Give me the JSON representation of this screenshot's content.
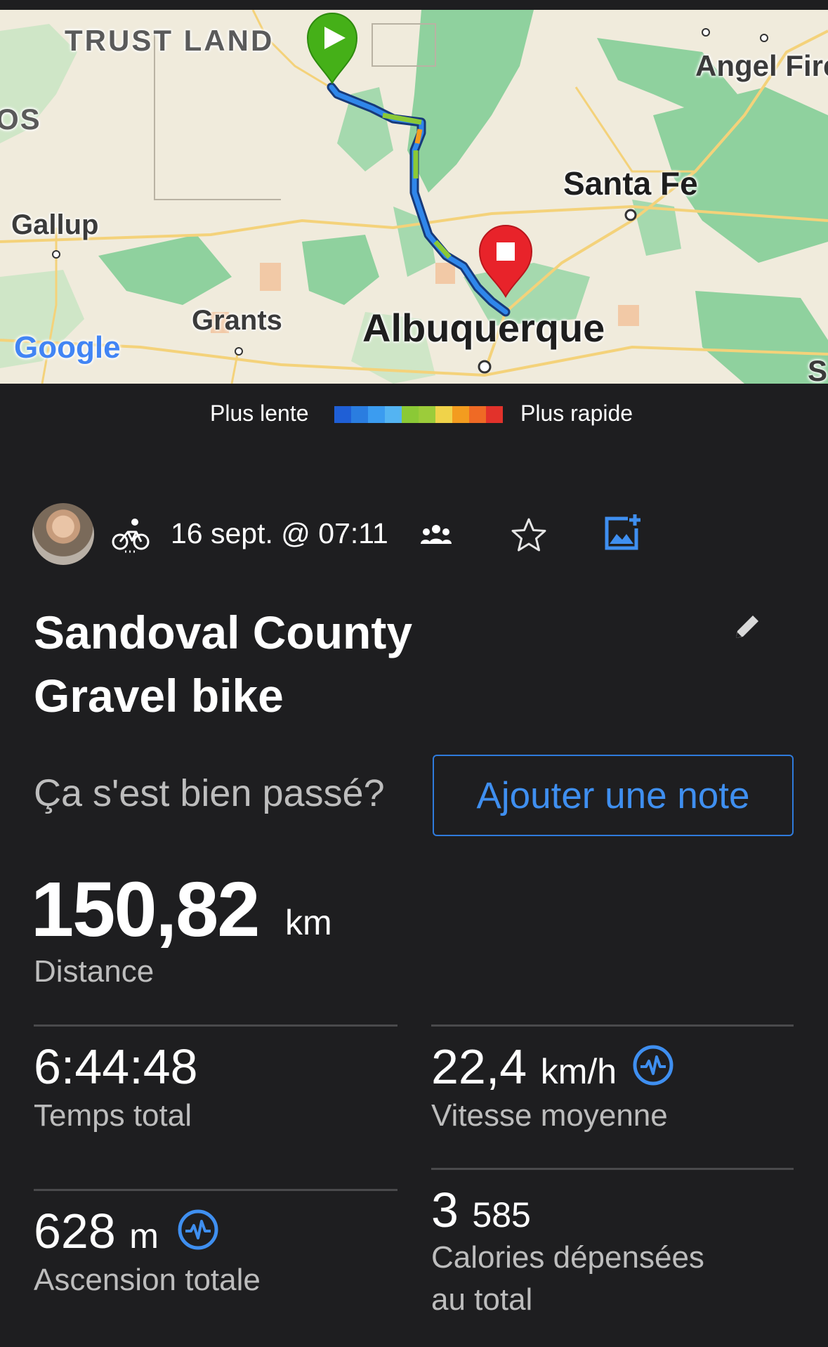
{
  "map": {
    "labels": {
      "trust_land": "TRUST LAND",
      "os": "OS",
      "gallup": "Gallup",
      "grants": "Grants",
      "albuquerque": "Albuquerque",
      "santa_fe": "Santa Fe",
      "angel_fire": "Angel Fire",
      "s_edge": "S",
      "google": "Google"
    },
    "start_marker_icon": "play-icon",
    "end_marker_icon": "stop-icon"
  },
  "legend": {
    "slower_label": "Plus lente",
    "faster_label": "Plus rapide",
    "colors": [
      "#1f5fd6",
      "#2a7de0",
      "#3b9cf0",
      "#54b4f2",
      "#8bc936",
      "#9ccc3a",
      "#f0d34a",
      "#f39c1f",
      "#ef6a25",
      "#e2322b"
    ]
  },
  "activity": {
    "activity_type_icon": "bike-icon",
    "date": "16 sept. @ 07:11",
    "title_line1": "Sandoval County",
    "title_line2": "Gravel bike",
    "question": "Ça s'est bien passé?",
    "add_note_label": "Ajouter une note"
  },
  "stats": {
    "distance": {
      "value": "150,82",
      "unit": "km",
      "label": "Distance"
    },
    "total_time": {
      "value": "6:44:48",
      "label": "Temps total"
    },
    "avg_speed": {
      "value": "22,4",
      "unit": "km/h",
      "label": "Vitesse moyenne"
    },
    "ascent": {
      "value": "628",
      "unit": "m",
      "label": "Ascension totale"
    },
    "calories": {
      "value_big": "3",
      "value_small": "585",
      "label_line1": "Calories dépensées",
      "label_line2": "au total"
    }
  },
  "colors": {
    "accent": "#3f8ff0",
    "background": "#1e1e20",
    "muted_text": "#bdbdbd"
  }
}
